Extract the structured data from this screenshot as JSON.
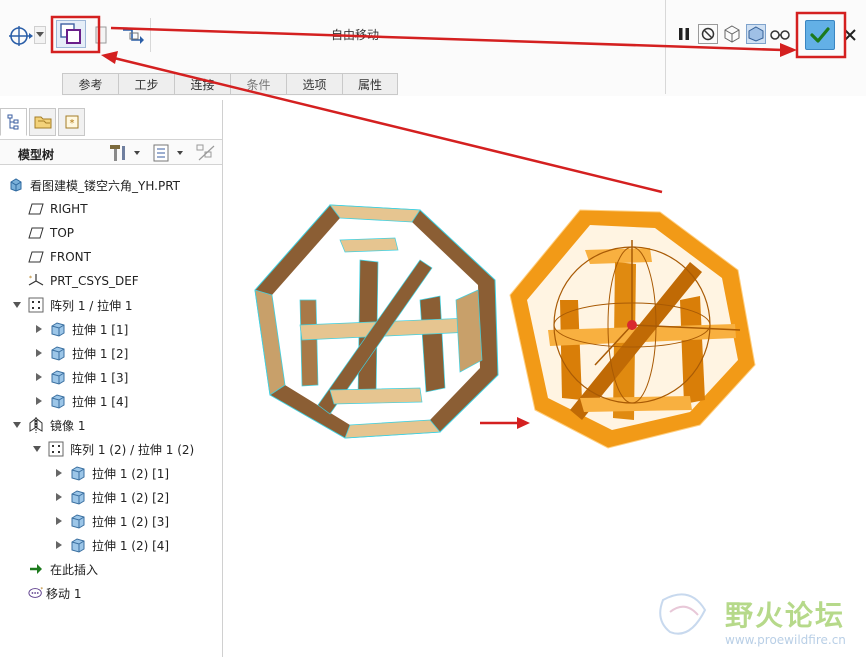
{
  "toolbar": {
    "operation_title": "自由移动",
    "icons": [
      "csys-dragger-icon",
      "dropdown-arrow-icon",
      "free-move-icon",
      "copy-icon",
      "relocate-icon",
      "pause-icon",
      "no-preview-icon",
      "preview-icon",
      "verify-icon",
      "glasses-icon",
      "ok-check-icon",
      "cancel-x-icon"
    ],
    "tabs": [
      {
        "label": "参考",
        "enabled": true
      },
      {
        "label": "工步",
        "enabled": true
      },
      {
        "label": "连接",
        "enabled": true
      },
      {
        "label": "条件",
        "enabled": false
      },
      {
        "label": "选项",
        "enabled": true
      },
      {
        "label": "属性",
        "enabled": true
      }
    ]
  },
  "model_tree": {
    "title": "模型树",
    "panel_tabs": [
      "model-tree-icon",
      "folder-browser-icon",
      "favorites-icon"
    ],
    "header_icons": [
      "tree-settings-icon",
      "tree-columns-icon",
      "tree-filter-icon"
    ],
    "nodes": [
      {
        "id": "root",
        "label": "看图建模_镂空六角_YH.PRT",
        "icon": "part-icon",
        "expander": "none"
      },
      {
        "id": "right",
        "label": "RIGHT",
        "icon": "datum-plane-icon",
        "expander": "none"
      },
      {
        "id": "top",
        "label": "TOP",
        "icon": "datum-plane-icon",
        "expander": "none"
      },
      {
        "id": "front",
        "label": "FRONT",
        "icon": "datum-plane-icon",
        "expander": "none"
      },
      {
        "id": "csys",
        "label": "PRT_CSYS_DEF",
        "icon": "csys-icon",
        "expander": "none"
      },
      {
        "id": "pattern1",
        "label": "阵列 1 / 拉伸 1",
        "icon": "pattern-icon",
        "expander": "expanded"
      },
      {
        "id": "ext1",
        "label": "拉伸 1 [1]",
        "icon": "extrude-icon",
        "expander": "collapsed"
      },
      {
        "id": "ext2",
        "label": "拉伸 1 [2]",
        "icon": "extrude-icon",
        "expander": "collapsed"
      },
      {
        "id": "ext3",
        "label": "拉伸 1 [3]",
        "icon": "extrude-icon",
        "expander": "collapsed"
      },
      {
        "id": "ext4",
        "label": "拉伸 1 [4]",
        "icon": "extrude-icon",
        "expander": "collapsed"
      },
      {
        "id": "mirror1",
        "label": "镜像 1",
        "icon": "mirror-icon",
        "expander": "expanded"
      },
      {
        "id": "pattern2",
        "label": "阵列 1 (2) / 拉伸 1 (2)",
        "icon": "pattern-icon",
        "expander": "expanded"
      },
      {
        "id": "ext21",
        "label": "拉伸 1 (2) [1]",
        "icon": "extrude-icon",
        "expander": "collapsed"
      },
      {
        "id": "ext22",
        "label": "拉伸 1 (2) [2]",
        "icon": "extrude-icon",
        "expander": "collapsed"
      },
      {
        "id": "ext23",
        "label": "拉伸 1 (2) [3]",
        "icon": "extrude-icon",
        "expander": "collapsed"
      },
      {
        "id": "ext24",
        "label": "拉伸 1 (2) [4]",
        "icon": "extrude-icon",
        "expander": "collapsed"
      },
      {
        "id": "insert",
        "label": "在此插入",
        "icon": "insert-here-arrow-icon",
        "expander": "none"
      },
      {
        "id": "move1",
        "label": "移动 1",
        "icon": "move-feature-icon",
        "expander": "none"
      }
    ]
  },
  "watermark": {
    "text": "野火论坛",
    "url": "www.proewildfire.cn"
  },
  "colors": {
    "annotation_red": "#d42020",
    "preview_orange": "#f29a17",
    "model_tan": "#e6c590",
    "model_brown": "#8b5e34",
    "edge_cyan": "#3fd0e0",
    "ok_button": "#63b0e6"
  }
}
